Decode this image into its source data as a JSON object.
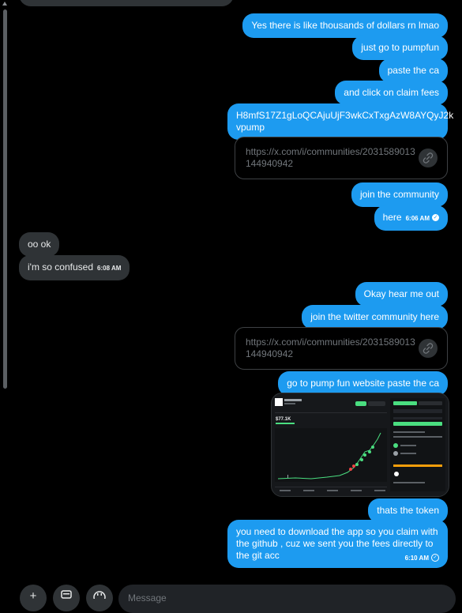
{
  "messages": {
    "m1": "Yes there is like thousands of dollars rn lmao",
    "m2": "just go to pumpfun",
    "m3": "paste the ca",
    "m4": "and click on claim fees",
    "m5_line1": "H8mfS17Z1gLoQCAjuUjF3wkCxTxgAzW8AYQyJ2k",
    "m5_line2": "vpump",
    "link1_url": "https://x.com/i/communities/2031589013144940942",
    "m6": "join the community",
    "m7": "here",
    "m7_time": "6:06 AM",
    "r1": "oo ok",
    "r2": "i'm so confused",
    "r2_time": "6:08 AM",
    "m8": "Okay hear me out",
    "m9": "join the twitter community here",
    "link2_url": "https://x.com/i/communities/2031589013144940942",
    "m10": "go to pump fun website paste the ca",
    "m11": "thats the token",
    "m12_line1": "you need to download the app so you claim with",
    "m12_line2": "the github , cuz we sent you the fees directly to",
    "m12_line3": "the git acc",
    "m12_time": "6:10 AM"
  },
  "screenshot": {
    "price": "$77.1K"
  },
  "composer": {
    "placeholder": "Message"
  },
  "icons": {
    "link": "link-icon",
    "add": "plus-icon",
    "gif": "gif-icon",
    "emoji": "emoji-icon",
    "read": "read-check-icon",
    "sent": "sent-check-icon"
  },
  "colors": {
    "outgoing": "#1d9bf0",
    "incoming": "#2f3336",
    "background": "#000000"
  }
}
